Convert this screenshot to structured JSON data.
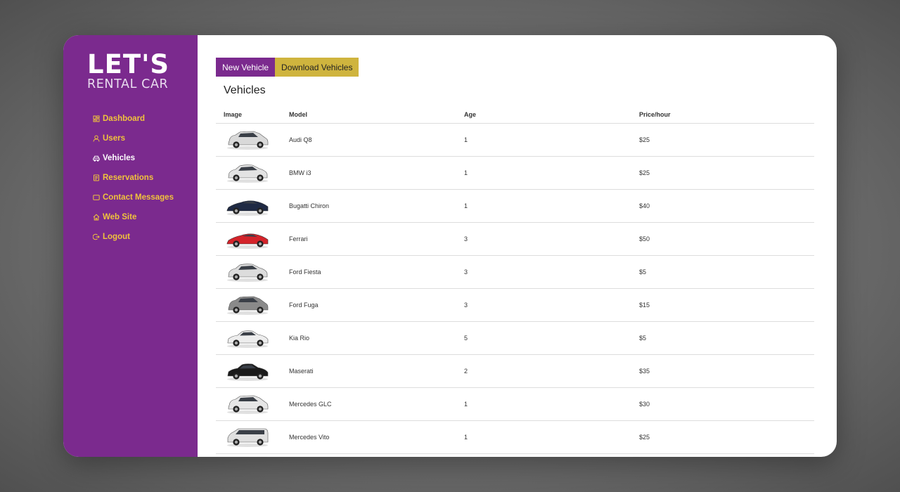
{
  "brand": {
    "line1": "LET'S",
    "line2": "RENTAL CAR"
  },
  "sidebar": {
    "items": [
      {
        "label": "Dashboard",
        "icon": "dashboard-icon",
        "active": false
      },
      {
        "label": "Users",
        "icon": "user-icon",
        "active": false
      },
      {
        "label": "Vehicles",
        "icon": "car-icon",
        "active": true
      },
      {
        "label": "Reservations",
        "icon": "document-icon",
        "active": false
      },
      {
        "label": "Contact Messages",
        "icon": "message-icon",
        "active": false
      },
      {
        "label": "Web Site",
        "icon": "home-icon",
        "active": false
      },
      {
        "label": "Logout",
        "icon": "logout-icon",
        "active": false
      }
    ]
  },
  "toolbar": {
    "new_label": "New Vehicle",
    "download_label": "Download Vehicles"
  },
  "page": {
    "title": "Vehicles"
  },
  "table": {
    "headers": [
      "Image",
      "Model",
      "Age",
      "Price/hour"
    ],
    "rows": [
      {
        "model": "Audi Q8",
        "age": "1",
        "price": "$25",
        "color": "#d9d9d9",
        "shape": "suv"
      },
      {
        "model": "BMW i3",
        "age": "1",
        "price": "$25",
        "color": "#e3e3e3",
        "shape": "hatch"
      },
      {
        "model": "Bugatti Chiron",
        "age": "1",
        "price": "$40",
        "color": "#1f2a44",
        "shape": "sport"
      },
      {
        "model": "Ferrari",
        "age": "3",
        "price": "$50",
        "color": "#d4232a",
        "shape": "sport"
      },
      {
        "model": "Ford Fiesta",
        "age": "3",
        "price": "$5",
        "color": "#dcdcdc",
        "shape": "hatch"
      },
      {
        "model": "Ford Fuga",
        "age": "3",
        "price": "$15",
        "color": "#8a8a8a",
        "shape": "suv"
      },
      {
        "model": "Kia Rio",
        "age": "5",
        "price": "$5",
        "color": "#ededed",
        "shape": "sedan"
      },
      {
        "model": "Maserati",
        "age": "2",
        "price": "$35",
        "color": "#1b1b1b",
        "shape": "sedan"
      },
      {
        "model": "Mercedes GLC",
        "age": "1",
        "price": "$30",
        "color": "#e6e6e6",
        "shape": "suv"
      },
      {
        "model": "Mercedes Vito",
        "age": "1",
        "price": "$25",
        "color": "#e0e0e0",
        "shape": "van"
      }
    ]
  },
  "colors": {
    "sidebar": "#7b2a8e",
    "accent_gold": "#cfb43e",
    "nav_text": "#f0c33c"
  }
}
